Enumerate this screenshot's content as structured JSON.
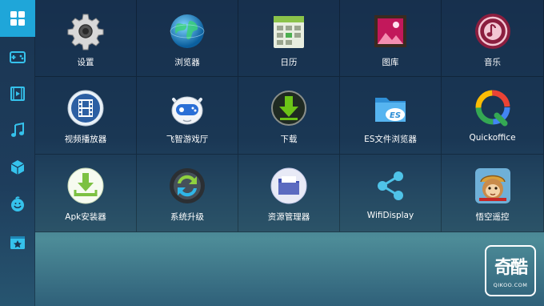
{
  "sidebar": {
    "items": [
      {
        "icon": "grid-icon",
        "active": true
      },
      {
        "icon": "gamepad-icon",
        "active": false
      },
      {
        "icon": "film-icon",
        "active": false
      },
      {
        "icon": "music-note-icon",
        "active": false
      },
      {
        "icon": "cube-icon",
        "active": false
      },
      {
        "icon": "smiley-icon",
        "active": false
      },
      {
        "icon": "favorites-star-icon",
        "active": false
      }
    ],
    "active_color": "#1fa6d9"
  },
  "apps": [
    {
      "label": "设置",
      "icon": "gear-icon"
    },
    {
      "label": "浏览器",
      "icon": "globe-icon"
    },
    {
      "label": "日历",
      "icon": "calendar-icon"
    },
    {
      "label": "图库",
      "icon": "gallery-icon"
    },
    {
      "label": "音乐",
      "icon": "music-disc-icon"
    },
    {
      "label": "视频播放器",
      "icon": "video-player-icon"
    },
    {
      "label": "飞智游戏厅",
      "icon": "flydigi-robot-icon"
    },
    {
      "label": "下载",
      "icon": "download-icon"
    },
    {
      "label": "ES文件浏览器",
      "icon": "es-folder-icon"
    },
    {
      "label": "Quickoffice",
      "icon": "quickoffice-icon"
    },
    {
      "label": "Apk安装器",
      "icon": "apk-installer-icon"
    },
    {
      "label": "系统升级",
      "icon": "system-update-icon"
    },
    {
      "label": "资源管理器",
      "icon": "file-manager-icon"
    },
    {
      "label": "WifiDisplay",
      "icon": "share-icon"
    },
    {
      "label": "悟空遥控",
      "icon": "monkey-king-icon"
    }
  ],
  "watermark": {
    "main": "奇酷",
    "sub": "QIKOO.COM"
  }
}
